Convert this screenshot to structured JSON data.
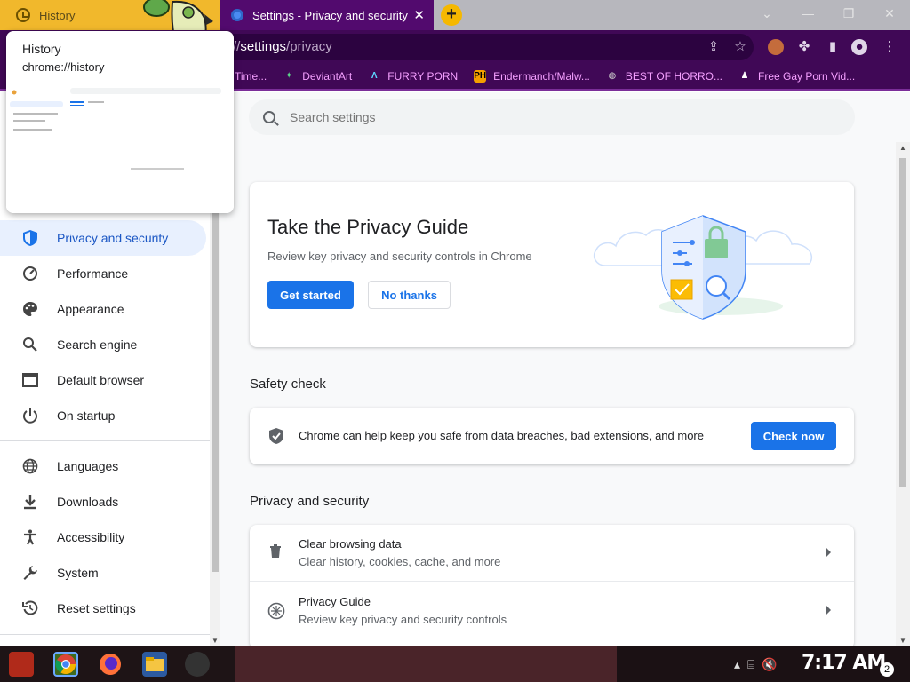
{
  "tabs": {
    "history": {
      "label": "History"
    },
    "settings": {
      "label": "Settings - Privacy and security",
      "close": "✕"
    },
    "new_tab": "+"
  },
  "window_controls": {
    "dropdown": "⌄",
    "minimize": "—",
    "restore": "❐",
    "close": "✕"
  },
  "omnibox": {
    "prefix": "//",
    "path_main": "settings",
    "path_rest": "/privacy"
  },
  "bookmarks": [
    {
      "label": "Time...",
      "icon_color": "#f5a0ff"
    },
    {
      "label": "DeviantArt",
      "icon_color": "#5cd68a"
    },
    {
      "label": "FURRY PORN",
      "icon_color": "#5dd8ff"
    },
    {
      "label": "Endermanch/Malw...",
      "icon_color": "#f4a000"
    },
    {
      "label": "BEST OF HORRO...",
      "icon_color": "#cccccc"
    },
    {
      "label": "Free Gay Porn Vid...",
      "icon_color": "#ffffff"
    }
  ],
  "popup": {
    "title": "History",
    "url": "chrome://history"
  },
  "sidebar": {
    "items": [
      {
        "label": "Privacy and security",
        "icon": "shield-icon",
        "glyph": "⛊",
        "active": true
      },
      {
        "label": "Performance",
        "icon": "speedometer-icon",
        "glyph": "◔"
      },
      {
        "label": "Appearance",
        "icon": "palette-icon",
        "glyph": "🎨"
      },
      {
        "label": "Search engine",
        "icon": "search-icon",
        "glyph": "⌕"
      },
      {
        "label": "Default browser",
        "icon": "browser-icon",
        "glyph": "▭"
      },
      {
        "label": "On startup",
        "icon": "power-icon",
        "glyph": "⏻"
      },
      {
        "label": "Languages",
        "icon": "globe-icon",
        "glyph": "🌐"
      },
      {
        "label": "Downloads",
        "icon": "download-icon",
        "glyph": "⤓"
      },
      {
        "label": "Accessibility",
        "icon": "accessibility-icon",
        "glyph": "♿"
      },
      {
        "label": "System",
        "icon": "wrench-icon",
        "glyph": "🔧"
      },
      {
        "label": "Reset settings",
        "icon": "reset-icon",
        "glyph": "↺"
      }
    ]
  },
  "search": {
    "placeholder": "Search settings"
  },
  "privacy_guide": {
    "title": "Take the Privacy Guide",
    "subtitle": "Review key privacy and security controls in Chrome",
    "get_started": "Get started",
    "no_thanks": "No thanks"
  },
  "safety_check": {
    "heading": "Safety check",
    "text": "Chrome can help keep you safe from data breaches, bad extensions, and more",
    "button": "Check now"
  },
  "privacy_section": {
    "heading": "Privacy and security",
    "rows": [
      {
        "title": "Clear browsing data",
        "subtitle": "Clear history, cookies, cache, and more",
        "icon": "trash-icon"
      },
      {
        "title": "Privacy Guide",
        "subtitle": "Review key privacy and security controls",
        "icon": "compass-icon"
      }
    ]
  },
  "taskbar": {
    "time": "7:17 AM",
    "notifications": "2"
  }
}
